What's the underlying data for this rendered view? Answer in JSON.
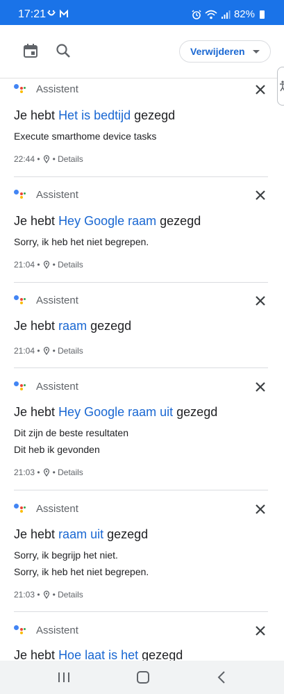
{
  "status_bar": {
    "time": "17:21",
    "notification_icons": [
      "alarm-icon",
      "wifi-icon",
      "signal-icon"
    ],
    "battery": "82%"
  },
  "app_bar": {
    "calendar_icon": "calendar-icon",
    "search_icon": "search-icon",
    "delete_button": "Verwijderen"
  },
  "items": [
    {
      "app": "Assistent",
      "prefix": "Je hebt",
      "query": "Het is bedtijd",
      "suffix": "gezegd",
      "responses": [
        "Execute smarthome device tasks"
      ],
      "time": "22:44",
      "details": "Details"
    },
    {
      "app": "Assistent",
      "prefix": "Je hebt",
      "query": "Hey Google raam",
      "suffix": "gezegd",
      "responses": [
        "Sorry, ik heb het niet begrepen."
      ],
      "time": "21:04",
      "details": "Details"
    },
    {
      "app": "Assistent",
      "prefix": "Je hebt",
      "query": "raam",
      "suffix": "gezegd",
      "responses": [],
      "time": "21:04",
      "details": "Details"
    },
    {
      "app": "Assistent",
      "prefix": "Je hebt",
      "query": "Hey Google raam uit",
      "suffix": "gezegd",
      "responses": [
        "Dit zijn de beste resultaten",
        "Dit heb ik gevonden"
      ],
      "time": "21:03",
      "details": "Details"
    },
    {
      "app": "Assistent",
      "prefix": "Je hebt",
      "query": "raam uit",
      "suffix": "gezegd",
      "responses": [
        "Sorry, ik begrijp het niet.",
        "Sorry, ik heb het niet begrepen."
      ],
      "time": "21:03",
      "details": "Details"
    },
    {
      "app": "Assistent",
      "prefix": "Je hebt",
      "query": "Hoe laat is het",
      "suffix": "gezegd",
      "responses": [],
      "time": "",
      "details": ""
    }
  ],
  "colors": {
    "accent": "#1a73e8",
    "query_text": "#1967d2"
  }
}
